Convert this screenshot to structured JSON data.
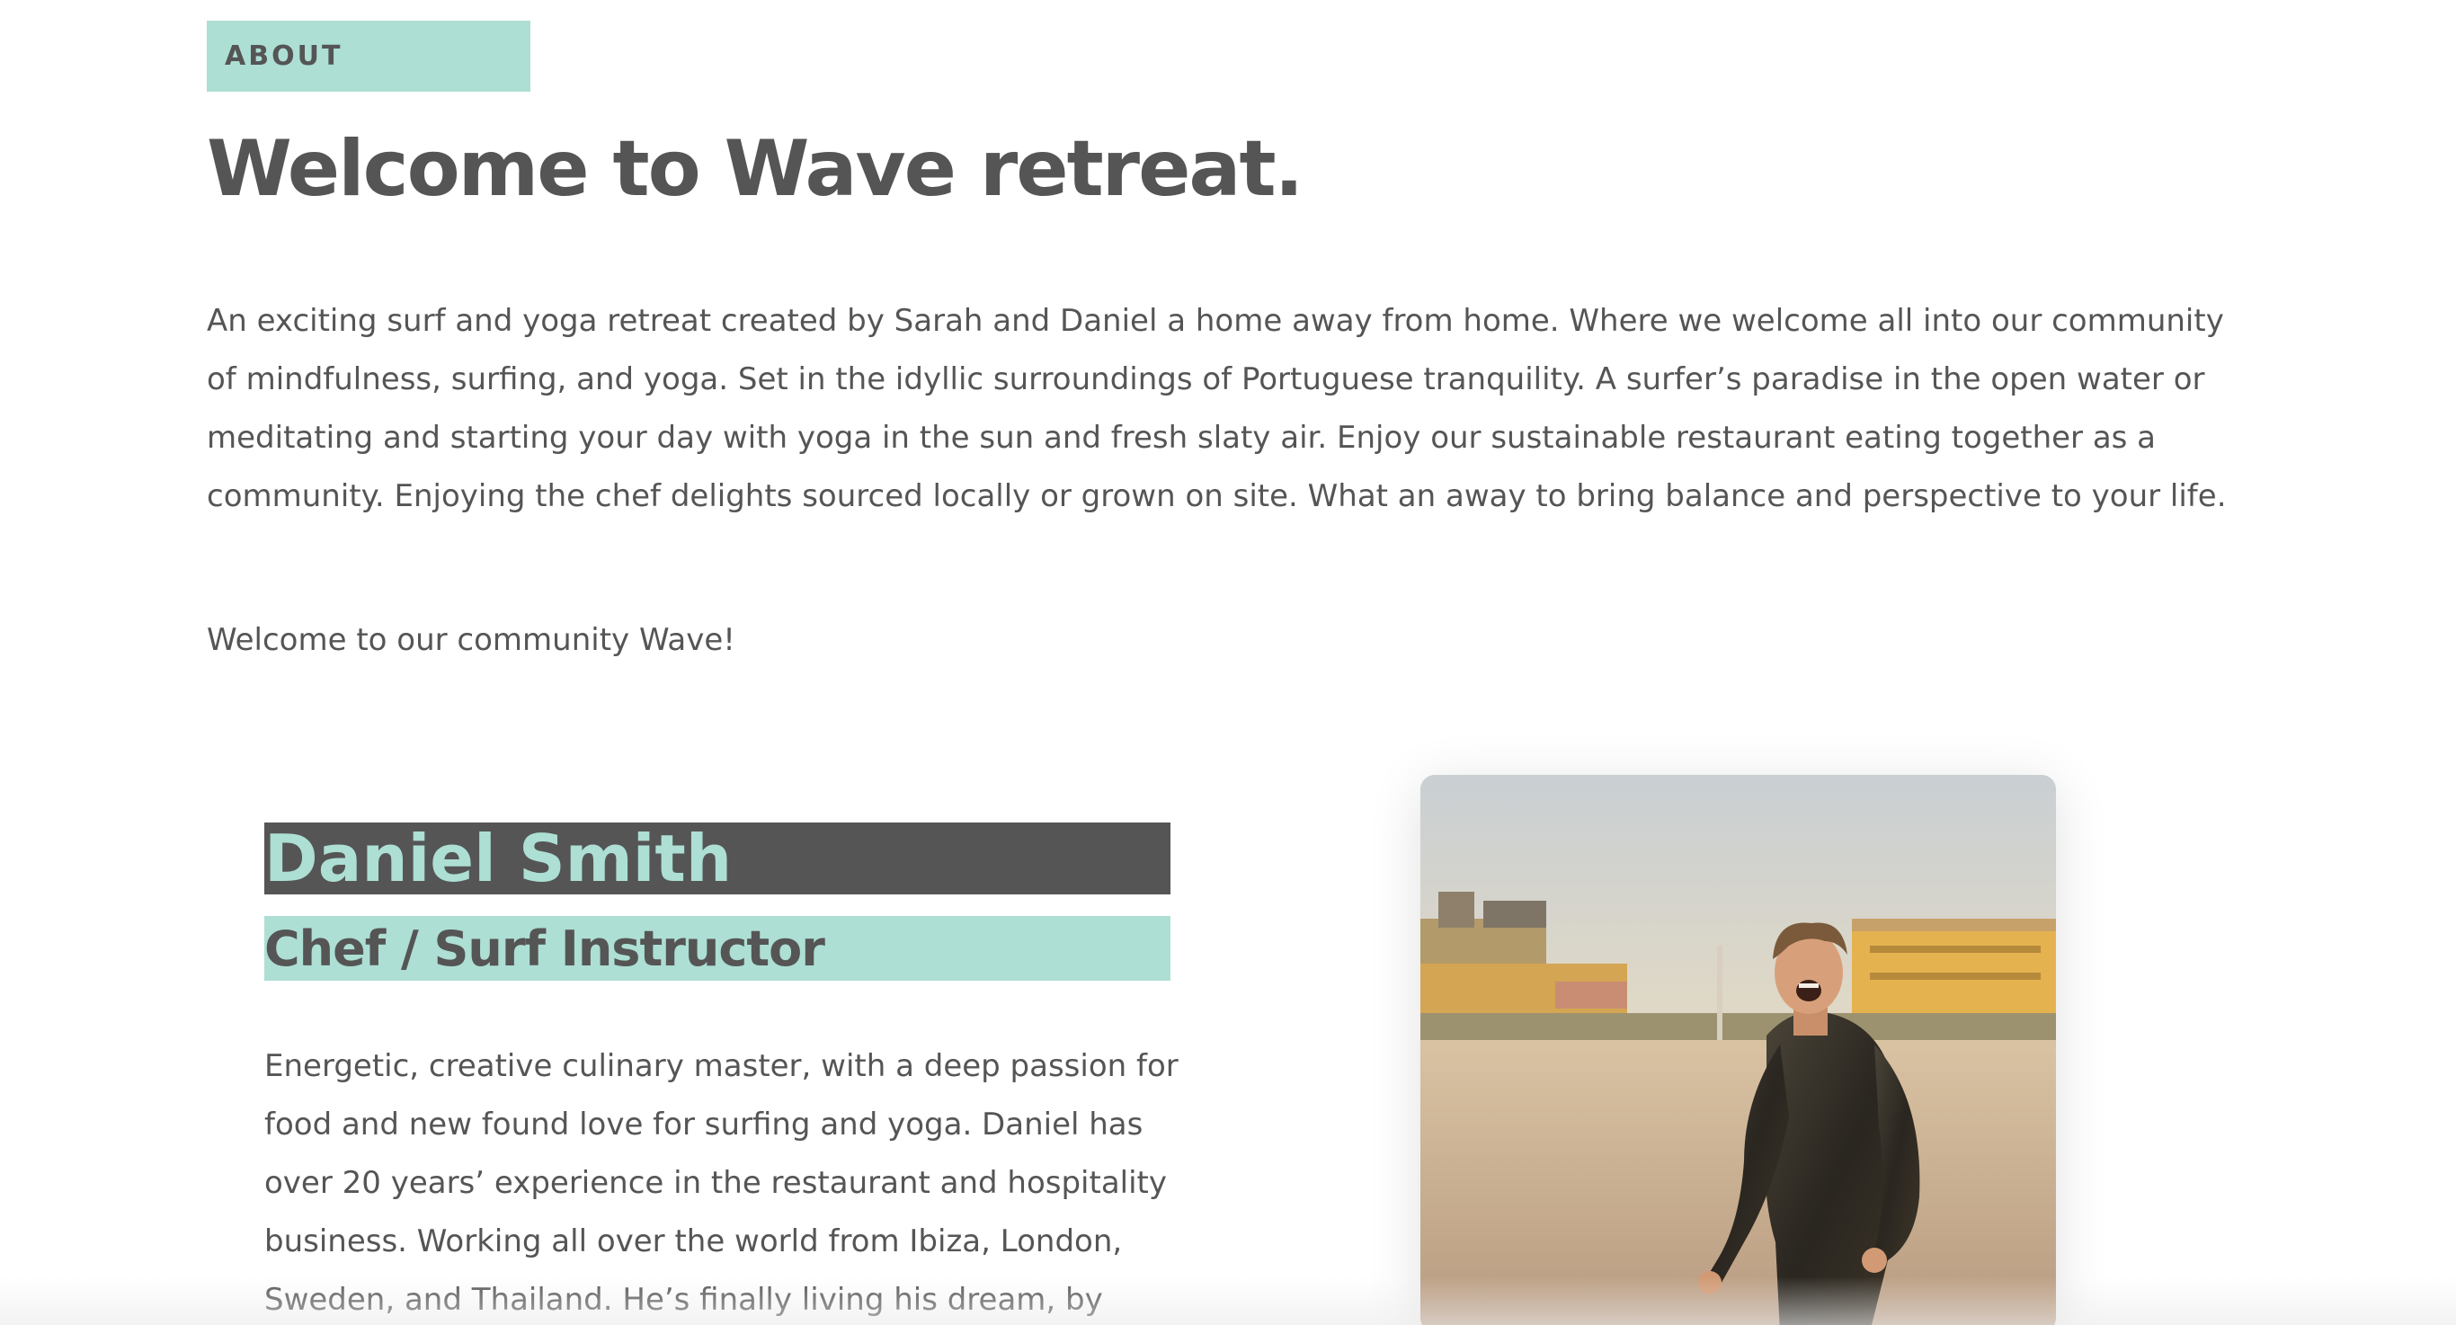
{
  "about": {
    "tag_label": "ABOUT",
    "title": "Welcome to Wave retreat.",
    "intro": "An exciting surf and yoga retreat created by Sarah and Daniel a home away from home. Where we welcome all into our community of mindfulness, surfing, and yoga. Set in the idyllic surroundings of Portuguese tranquility. A surfer’s paradise in the open water or meditating and starting your day with yoga in the sun and fresh slaty air. Enjoy our sustainable restaurant eating together as a community. Enjoying the chef delights sourced locally or grown on site. What an away to bring balance and perspective to your life.",
    "welcome_line": "Welcome to our community Wave!"
  },
  "profile": {
    "name": "Daniel Smith",
    "role": "Chef / Surf Instructor",
    "bio": "Energetic, creative culinary master, with a deep passion for food and new found love for surfing and yoga. Daniel has over 20 years’ experience in the restaurant and hospitality business. Working all over the world from Ibiza, London, Sweden, and Thailand. He’s finally living his dream, by",
    "photo_alt": "Daniel smiling on the beach in a wetsuit at sunset"
  },
  "colors": {
    "accent_mint": "#addfd4",
    "dark_gray": "#555555",
    "background": "#ffffff"
  }
}
